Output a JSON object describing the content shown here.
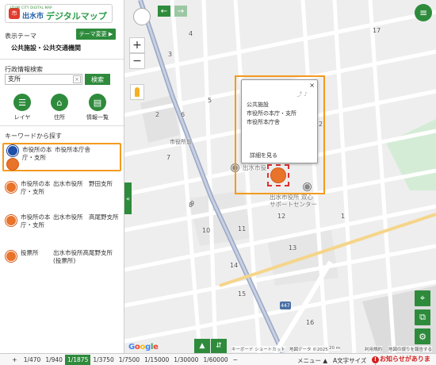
{
  "header": {
    "logo_small": "IZUMI CITY DIGITAL MAP",
    "logo_badge": "市",
    "logo_city": "出水市",
    "logo_title": "デジタルマップ"
  },
  "theme": {
    "label": "表示テーマ",
    "change_button": "テーマ変更 ▶",
    "current": "公共施設・公共交通機関"
  },
  "search": {
    "label": "行政情報検索",
    "value": "支所",
    "clear": "×",
    "button": "検索"
  },
  "tools": [
    {
      "icon": "layer-icon",
      "glyph": "☰",
      "label": "レイヤ"
    },
    {
      "icon": "home-icon",
      "glyph": "⌂",
      "label": "住所"
    },
    {
      "icon": "list-icon",
      "glyph": "▤",
      "label": "情報一覧"
    }
  ],
  "keyword": {
    "label": "キーワードから探す",
    "results": [
      {
        "category": "市役所の本庁・支所",
        "name": "市役所本庁舎"
      },
      {
        "category": "市役所の本庁・支所",
        "name": "出水市役所　野田支所"
      },
      {
        "category": "市役所の本庁・支所",
        "name": "出水市役所　高尾野支所"
      },
      {
        "category": "投票所",
        "name": "出水市役所高尾野支所(投票所)"
      }
    ]
  },
  "map_controls": {
    "zoom_in": "+",
    "zoom_out": "−",
    "back": "←",
    "forward": "→",
    "menu": "≡",
    "collapse": "«"
  },
  "popup": {
    "close": "×",
    "tools": "⤴ ♪",
    "lines": [
      "公共施設",
      "市役所の本庁・支所",
      "市役所本庁舎"
    ],
    "detail_link": "詳細を見る"
  },
  "map_labels": {
    "road_labels": [
      "市役所前"
    ],
    "block_numbers": [
      "2",
      "3",
      "4",
      "5",
      "6",
      "7",
      "8",
      "9",
      "10",
      "11",
      "12",
      "13",
      "14",
      "15",
      "16",
      "17",
      "1",
      "2",
      "4",
      "5",
      "8",
      "9",
      "10",
      "11",
      "12",
      "13",
      "14"
    ],
    "facility_label": "出水市役",
    "support_center": "出水市役所 双心\nサポートセンター",
    "route_number": "447"
  },
  "attribution": {
    "google": [
      "G",
      "o",
      "o",
      "g",
      "l",
      "e"
    ],
    "shortcuts": "キーボード ショートカット",
    "map_data": "地図データ ©2025",
    "scale": "20 m",
    "terms": "利用規約",
    "report": "地図の誤りを報告する"
  },
  "scalebar": {
    "plus": "+",
    "items": [
      "1/470",
      "1/940",
      "1/1875",
      "1/3750",
      "1/7500",
      "1/15000",
      "1/30000",
      "1/60000"
    ],
    "active": "1/1875",
    "minus": "−"
  },
  "footer": {
    "menu": "メニュー ▲",
    "font_size": "文字サイズ",
    "notice": "お知らせがあります。"
  },
  "colors": {
    "brand_green": "#2e8b3c",
    "highlight_orange": "#f39a1e",
    "notice_red": "#d62020"
  }
}
